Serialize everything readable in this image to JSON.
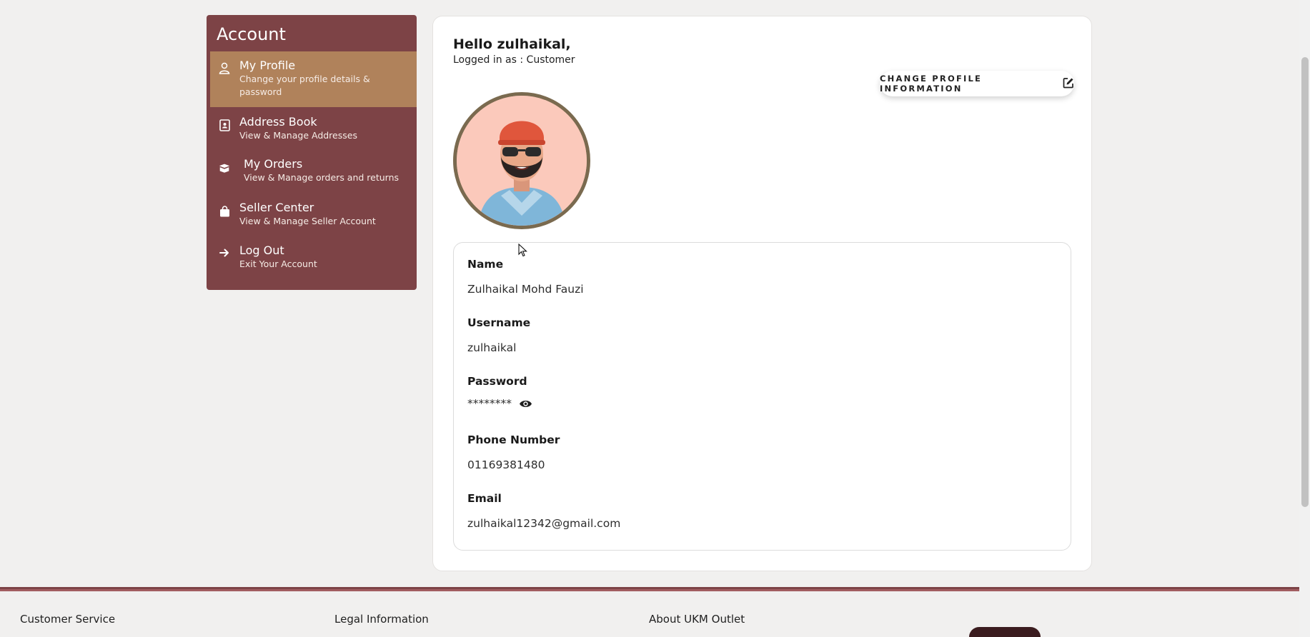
{
  "sidebar": {
    "title": "Account",
    "items": [
      {
        "label": "My Profile",
        "sub": "Change your profile details & password",
        "icon": "user-icon"
      },
      {
        "label": "Address Book",
        "sub": "View & Manage Addresses",
        "icon": "contact-book-icon"
      },
      {
        "label": "My Orders",
        "sub": "View & Manage orders and returns",
        "icon": "box-icon"
      },
      {
        "label": "Seller Center",
        "sub": "View & Manage Seller Account",
        "icon": "bag-icon"
      },
      {
        "label": "Log Out",
        "sub": "Exit Your Account",
        "icon": "arrow-right-icon"
      }
    ]
  },
  "profile": {
    "greeting": "Hello zulhaikal,",
    "role": "Logged in as : Customer",
    "change_button": "CHANGE PROFILE INFORMATION",
    "fields": [
      {
        "label": "Name",
        "value": "Zulhaikal Mohd Fauzi"
      },
      {
        "label": "Username",
        "value": "zulhaikal"
      },
      {
        "label": "Password",
        "value": "********"
      },
      {
        "label": "Phone Number",
        "value": "01169381480"
      },
      {
        "label": "Email",
        "value": "zulhaikal12342@gmail.com"
      }
    ]
  },
  "footer": {
    "columns": [
      "Customer Service",
      "Legal Information",
      "About UKM Outlet"
    ]
  },
  "colors": {
    "sidebar_bg": "#7d4346",
    "active_item": "#b0825b",
    "page_bg": "#f1f0ef"
  }
}
